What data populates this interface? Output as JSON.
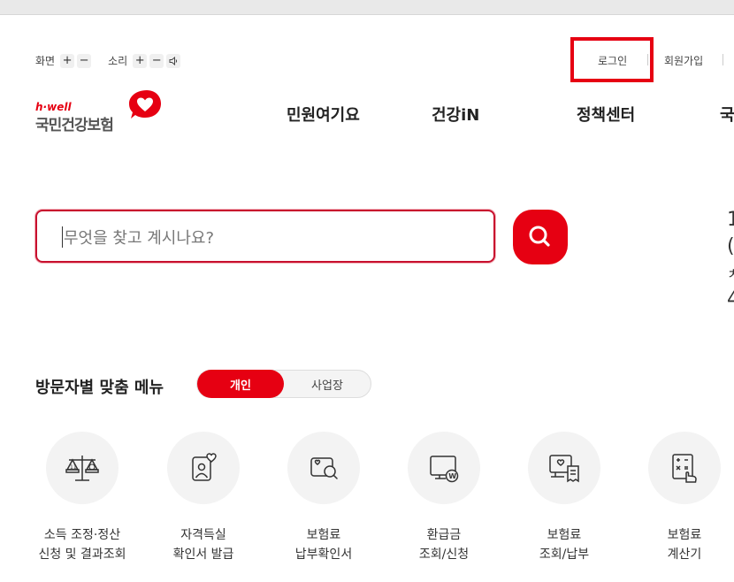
{
  "utility": {
    "screen_label": "화면",
    "sound_label": "소리",
    "plus": "+",
    "minus": "−",
    "login": "로그인",
    "signup": "회원가입"
  },
  "logo": {
    "english": "h·well",
    "korean": "국민건강보험",
    "brand_color": "#e60012"
  },
  "nav": [
    "민원여기요",
    "건강iN",
    "정책센터",
    "국"
  ],
  "search": {
    "placeholder": "무엇을 찾고 계시나요?",
    "button_icon": "search-icon"
  },
  "edge_chars": [
    "1",
    "(",
    "ㅊ",
    "4"
  ],
  "visitor_menu": {
    "title": "방문자별 맞춤 메뉴",
    "tabs": [
      "개인",
      "사업장"
    ],
    "active_tab": "개인"
  },
  "services": [
    {
      "line1": "소득 조정·정산",
      "line2": "신청 및 결과조회",
      "icon": "scale-icon"
    },
    {
      "line1": "자격득실",
      "line2": "확인서 발급",
      "icon": "person-heart-icon"
    },
    {
      "line1": "보험료",
      "line2": "납부확인서",
      "icon": "document-search-icon"
    },
    {
      "line1": "환급금",
      "line2": "조회/신청",
      "icon": "monitor-won-icon"
    },
    {
      "line1": "보험료",
      "line2": "조회/납부",
      "icon": "computer-receipt-icon"
    },
    {
      "line1": "보험료",
      "line2": "계산기",
      "icon": "calculator-hand-icon"
    }
  ]
}
